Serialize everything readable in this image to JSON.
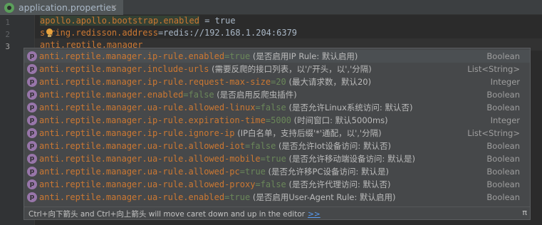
{
  "tab": {
    "title": "application.properties",
    "close": "×"
  },
  "gutter": {
    "lines": [
      "1",
      "2",
      "3"
    ]
  },
  "code": {
    "line1": {
      "key": "apollo.apollo.bootstrap.enabled",
      "value": " = true"
    },
    "line2": {
      "key_pre": "s",
      "key_post": "ring.redisson.address",
      "value": "=redis://192.168.1.204:6379"
    },
    "line3": {
      "key": "anti.reptile.manager"
    }
  },
  "completion": {
    "items": [
      {
        "name": "anti.reptile.manager.ip-rule.enabled",
        "default": "=true",
        "desc": " (是否启用IP Rule: 默认启用)",
        "type": "Boolean"
      },
      {
        "name": "anti.reptile.manager.include-urls",
        "default": "",
        "desc": " (需要反爬的接口列表，以'/'开头，以','分隔)",
        "type": "List<String>"
      },
      {
        "name": "anti.reptile.manager.ip-rule.request-max-size",
        "default": "=20",
        "desc": " (最大请求数，默认20)",
        "type": "Integer"
      },
      {
        "name": "anti.reptile.manager.enabled",
        "default": "=false",
        "desc": " (是否启用反爬虫插件)",
        "type": "Boolean"
      },
      {
        "name": "anti.reptile.manager.ua-rule.allowed-linux",
        "default": "=false",
        "desc": " (是否允许Linux系统访问: 默认否)",
        "type": "Boolean"
      },
      {
        "name": "anti.reptile.manager.ip-rule.expiration-time",
        "default": "=5000",
        "desc": " (时间窗口: 默认5000ms)",
        "type": "Integer"
      },
      {
        "name": "anti.reptile.manager.ip-rule.ignore-ip",
        "default": "",
        "desc": " (IP白名单，支持后缀'*'通配，以','分隔)",
        "type": "List<String>"
      },
      {
        "name": "anti.reptile.manager.ua-rule.allowed-iot",
        "default": "=false",
        "desc": " (是否允许Iot设备访问: 默认否)",
        "type": "Boolean"
      },
      {
        "name": "anti.reptile.manager.ua-rule.allowed-mobile",
        "default": "=true",
        "desc": " (是否允许移动端设备访问: 默认是)",
        "type": "Boolean"
      },
      {
        "name": "anti.reptile.manager.ua-rule.allowed-pc",
        "default": "=true",
        "desc": " (是否允许移PC设备访问: 默认是)",
        "type": "Boolean"
      },
      {
        "name": "anti.reptile.manager.ua-rule.allowed-proxy",
        "default": "=false",
        "desc": " (是否允许代理访问: 默认否)",
        "type": "Boolean"
      },
      {
        "name": "anti.reptile.manager.ua-rule.enabled",
        "default": "=true",
        "desc": " (是否启用User-Agent Rule: 默认启用)",
        "type": "Boolean"
      }
    ],
    "item_icon": "p",
    "hint": "Ctrl+向下箭头 and Ctrl+向上箭头 will move caret down and up in the editor",
    "hint_link": ">>",
    "pi": "π"
  }
}
